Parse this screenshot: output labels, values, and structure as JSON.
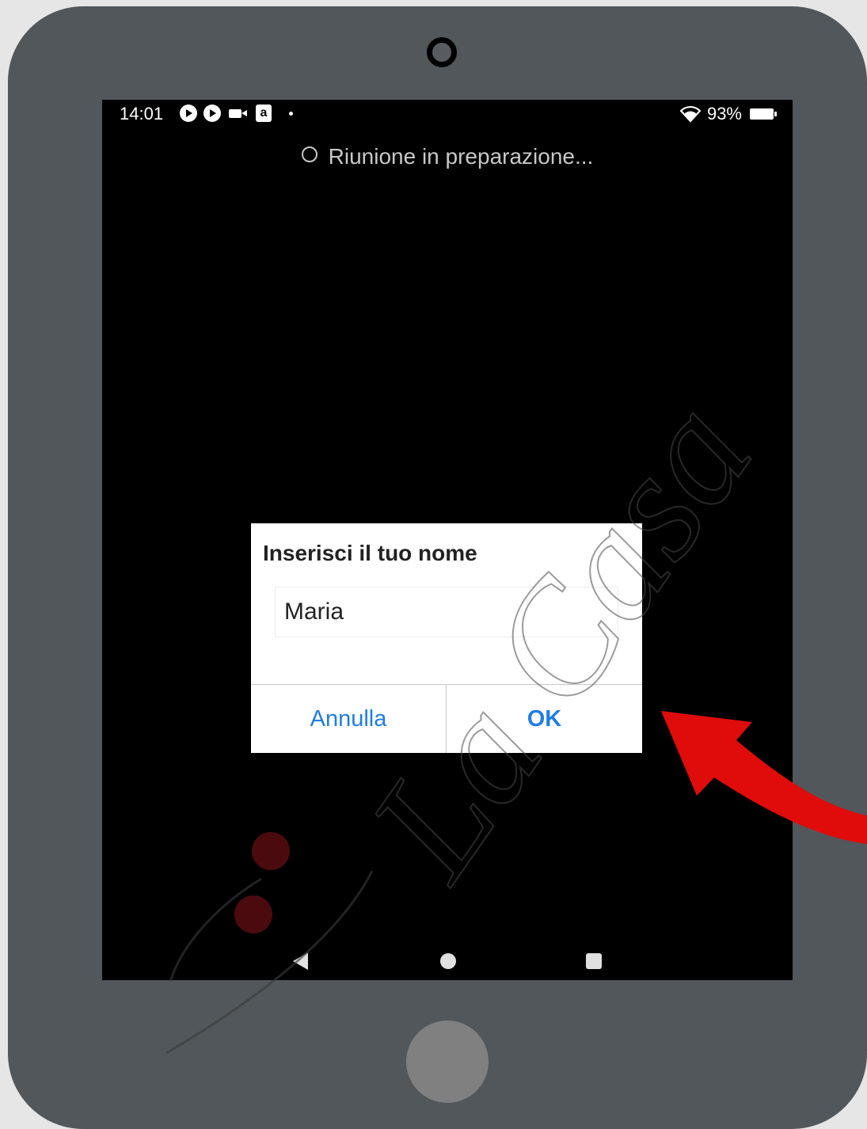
{
  "status_bar": {
    "time": "14:01",
    "amazon_icon_glyph": "a",
    "battery": "93%",
    "icons": [
      "play-circle-icon",
      "play-circle-icon",
      "video-camera-icon",
      "amazon-icon",
      "notification-dot-icon",
      "wifi-icon",
      "battery-icon"
    ]
  },
  "meeting": {
    "status": "Riunione in preparazione..."
  },
  "dialog": {
    "title": "Inserisci il tuo nome",
    "name_value": "Maria",
    "cancel_label": "Annulla",
    "ok_label": "OK"
  },
  "nav": {
    "icons": [
      "back-icon",
      "home-icon",
      "recent-apps-icon"
    ]
  },
  "watermark": {
    "text": "La Casa"
  },
  "colors": {
    "tablet_frame": "#52575b",
    "screen": "#000000",
    "button_text": "#1e7de8",
    "arrow": "#e00b0b",
    "home_button": "#808080"
  }
}
